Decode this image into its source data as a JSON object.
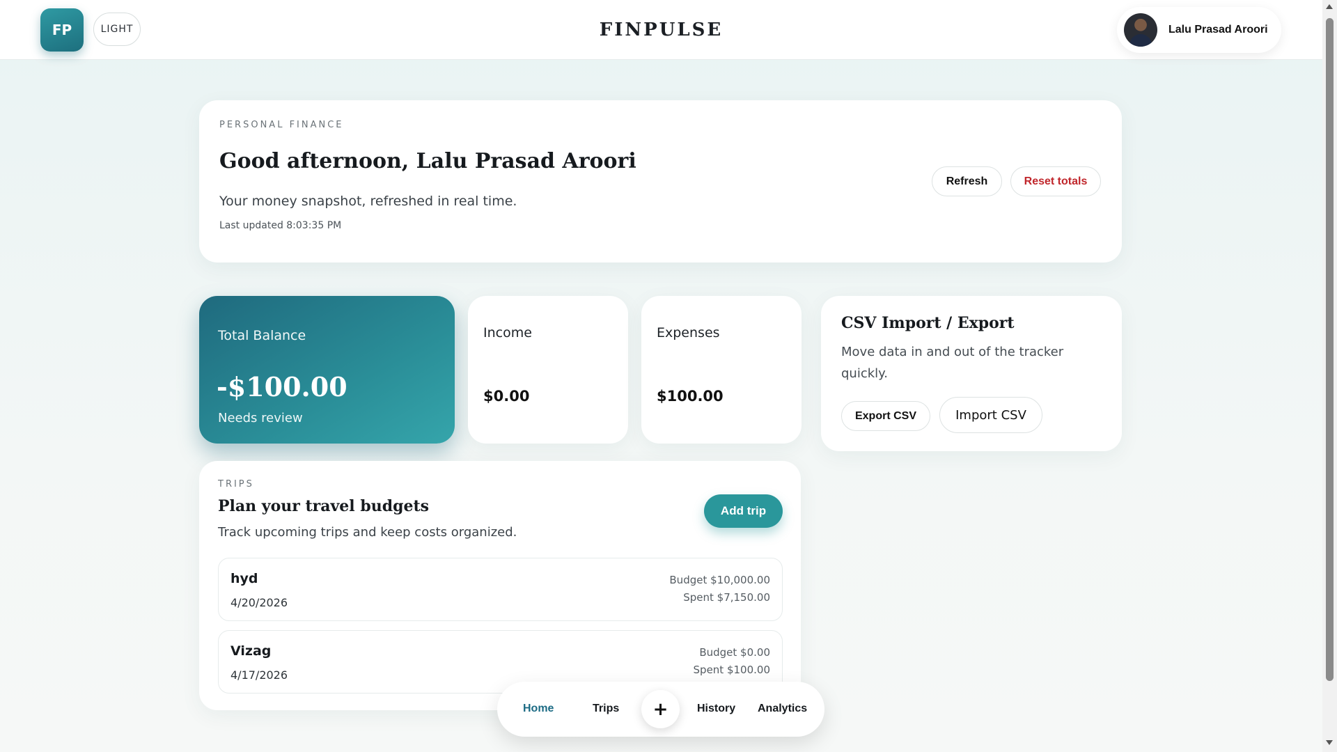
{
  "header": {
    "logo_initials": "FP",
    "theme_label": "LIGHT",
    "brand": "FINPULSE",
    "user_name": "Lalu Prasad Aroori"
  },
  "hero": {
    "eyebrow": "PERSONAL FINANCE",
    "greeting": "Good afternoon, Lalu Prasad Aroori",
    "subtitle": "Your money snapshot, refreshed in real time.",
    "last_updated": "Last updated 8:03:35 PM",
    "refresh_label": "Refresh",
    "reset_label": "Reset totals"
  },
  "balance": {
    "label": "Total Balance",
    "amount": "-$100.00",
    "status": "Needs review"
  },
  "income": {
    "label": "Income",
    "value": "$0.00"
  },
  "expenses": {
    "label": "Expenses",
    "value": "$100.00"
  },
  "csv": {
    "title": "CSV Import / Export",
    "description": "Move data in and out of the tracker quickly.",
    "export_label": "Export CSV",
    "import_label": "Import CSV"
  },
  "trips": {
    "eyebrow": "TRIPS",
    "title": "Plan your travel budgets",
    "subtitle": "Track upcoming trips and keep costs organized.",
    "add_label": "Add trip",
    "items": [
      {
        "name": "hyd",
        "date": "4/20/2026",
        "budget": "Budget $10,000.00",
        "spent": "Spent $7,150.00"
      },
      {
        "name": "Vizag",
        "date": "4/17/2026",
        "budget": "Budget $0.00",
        "spent": "Spent $100.00"
      }
    ]
  },
  "nav": {
    "home": "Home",
    "trips": "Trips",
    "add": "+",
    "history": "History",
    "analytics": "Analytics"
  },
  "colors": {
    "accent": "#2a979b",
    "balance_card": "#1f6a7e",
    "reset_red": "#c0262b",
    "nav_active": "#1c6b84"
  },
  "icons": {
    "add": "plus-icon",
    "avatar": "user-avatar"
  }
}
